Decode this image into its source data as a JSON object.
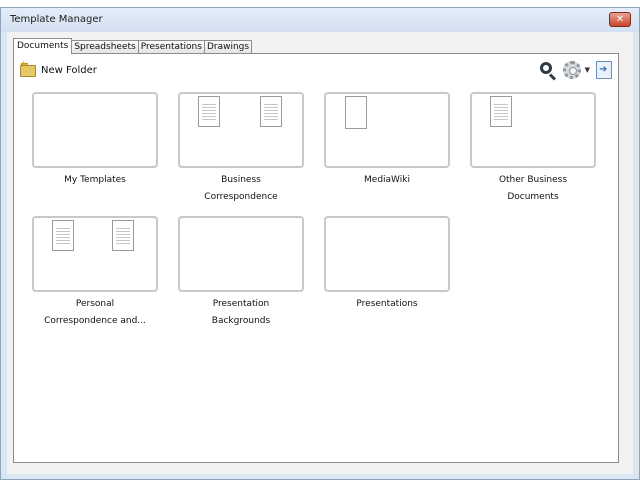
{
  "window": {
    "title": "Template Manager",
    "close_label": "✕"
  },
  "tabs": [
    {
      "label": "Documents",
      "active": true
    },
    {
      "label": "Spreadsheets",
      "active": false
    },
    {
      "label": "Presentations",
      "active": false
    },
    {
      "label": "Drawings",
      "active": false
    }
  ],
  "toolbar": {
    "new_folder_label": "New Folder",
    "icons": [
      "new-folder-icon",
      "search-icon",
      "gear-icon",
      "chevron-down-icon",
      "export-icon"
    ]
  },
  "folders": [
    {
      "name": "My Templates",
      "line1": "My Templates",
      "line2": ""
    },
    {
      "name": "Business Correspondence",
      "line1": "Business",
      "line2": "Correspondence"
    },
    {
      "name": "MediaWiki",
      "line1": "MediaWiki",
      "line2": ""
    },
    {
      "name": "Other Business Documents",
      "line1": "Other Business",
      "line2": "Documents"
    },
    {
      "name": "Personal Correspondence and...",
      "line1": "Personal",
      "line2": "Correspondence and..."
    },
    {
      "name": "Presentation Backgrounds",
      "line1": "Presentation",
      "line2": "Backgrounds"
    },
    {
      "name": "Presentations",
      "line1": "Presentations",
      "line2": ""
    }
  ]
}
